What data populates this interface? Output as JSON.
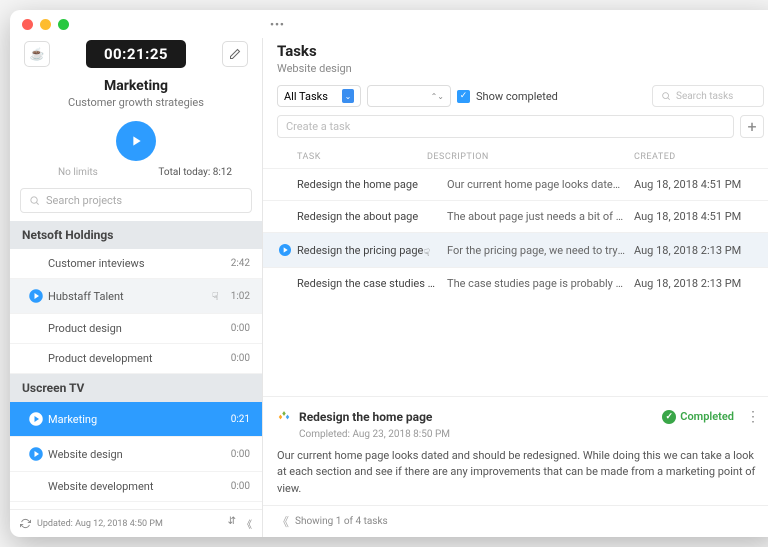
{
  "sidebar": {
    "timer": "00:21:25",
    "current_project": "Marketing",
    "current_project_sub": "Customer growth strategies",
    "limits_label": "No limits",
    "today_label": "Total today: 8:12",
    "search_placeholder": "Search projects",
    "groups": [
      {
        "name": "Netsoft Holdings",
        "items": [
          {
            "name": "Customer inteviews",
            "time": "2:42",
            "playing": false,
            "selected": false,
            "hover": false
          },
          {
            "name": "Hubstaff Talent",
            "time": "1:02",
            "playing": true,
            "selected": false,
            "hover": true
          },
          {
            "name": "Product design",
            "time": "0:00",
            "playing": false,
            "selected": false,
            "hover": false
          },
          {
            "name": "Product development",
            "time": "0:00",
            "playing": false,
            "selected": false,
            "hover": false
          }
        ]
      },
      {
        "name": "Uscreen TV",
        "items": [
          {
            "name": "Marketing",
            "time": "0:21",
            "playing": true,
            "selected": true,
            "hover": false
          },
          {
            "name": "Website design",
            "time": "0:00",
            "playing": true,
            "selected": false,
            "hover": false
          },
          {
            "name": "Website development",
            "time": "0:00",
            "playing": false,
            "selected": false,
            "hover": false
          }
        ]
      }
    ],
    "updated_label": "Updated: Aug 12, 2018 4:50 PM"
  },
  "main": {
    "title": "Tasks",
    "subtitle": "Website design",
    "filter_all": "All Tasks",
    "show_completed_label": "Show completed",
    "search_tasks_placeholder": "Search tasks",
    "create_placeholder": "Create a task",
    "columns": {
      "task": "Task",
      "desc": "Description",
      "created": "Created"
    },
    "rows": [
      {
        "task": "Redesign the home page",
        "desc": "Our current home page looks dated and should...",
        "created": "Aug 18, 2018 4:51 PM",
        "active": false,
        "playing": false
      },
      {
        "task": "Redesign the about page",
        "desc": "The about page just needs a bit of makeup, bec...",
        "created": "Aug 18, 2018 4:51 PM",
        "active": false,
        "playing": false
      },
      {
        "task": "Redesign the pricing page",
        "desc": "For the pricing page, we need to try out a differe...",
        "created": "Aug 18, 2018 2:13 PM",
        "active": true,
        "playing": true
      },
      {
        "task": "Redesign the case studies pa...",
        "desc": "The case studies page is probably the one that ...",
        "created": "Aug 18, 2018 2:13 PM",
        "active": false,
        "playing": false
      }
    ],
    "detail": {
      "title": "Redesign the home page",
      "completed_at": "Completed: Aug 23, 2018 8:50 PM",
      "status": "Completed",
      "body": "Our current home page looks dated and should be redesigned. While doing this we can take a look at each section and see if there are any improvements that can be made from a marketing point of view."
    },
    "footer_showing": "Showing 1 of 4 tasks"
  }
}
